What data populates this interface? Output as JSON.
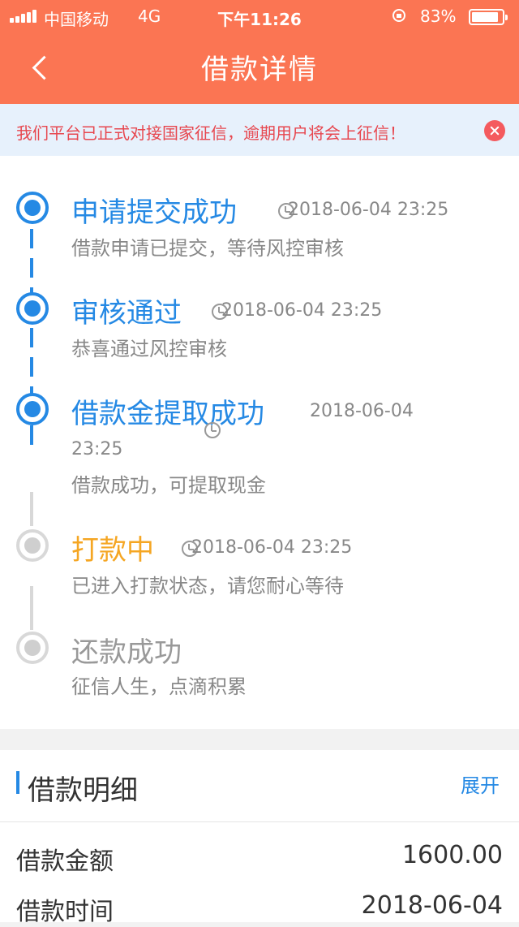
{
  "status_bar": {
    "carrier": "中国移动",
    "network": "4G",
    "time": "下午11:26",
    "battery": "83%"
  },
  "header": {
    "title": "借款详情"
  },
  "notice": {
    "text": "我们平台已正式对接国家征信，逾期用户将会上征信！"
  },
  "steps": [
    {
      "title": "申请提交成功",
      "time": "2018-06-04 23:25",
      "desc": "借款申请已提交，等待风控审核",
      "state": "done"
    },
    {
      "title": "审核通过",
      "time": "2018-06-04 23:25",
      "desc": "恭喜通过风控审核",
      "state": "done"
    },
    {
      "title": "借款金提取成功",
      "time_date": "2018-06-04",
      "time_clock": "23:25",
      "desc": "借款成功，可提取现金",
      "state": "done"
    },
    {
      "title": "打款中",
      "time": "2018-06-04 23:25",
      "desc": "已进入打款状态，请您耐心等待",
      "state": "current"
    },
    {
      "title": "还款成功",
      "desc": "征信人生，点滴积累",
      "state": "pending"
    }
  ],
  "colors": {
    "header": "#fb7553",
    "accent": "#2589e4",
    "current": "#f5a623",
    "notice_text": "#e7474f"
  },
  "details": {
    "title": "借款明细",
    "expand_label": "展开",
    "rows": [
      {
        "label": "借款金额",
        "value": "1600.00"
      },
      {
        "label": "借款时间",
        "value": "2018-06-04"
      }
    ]
  }
}
